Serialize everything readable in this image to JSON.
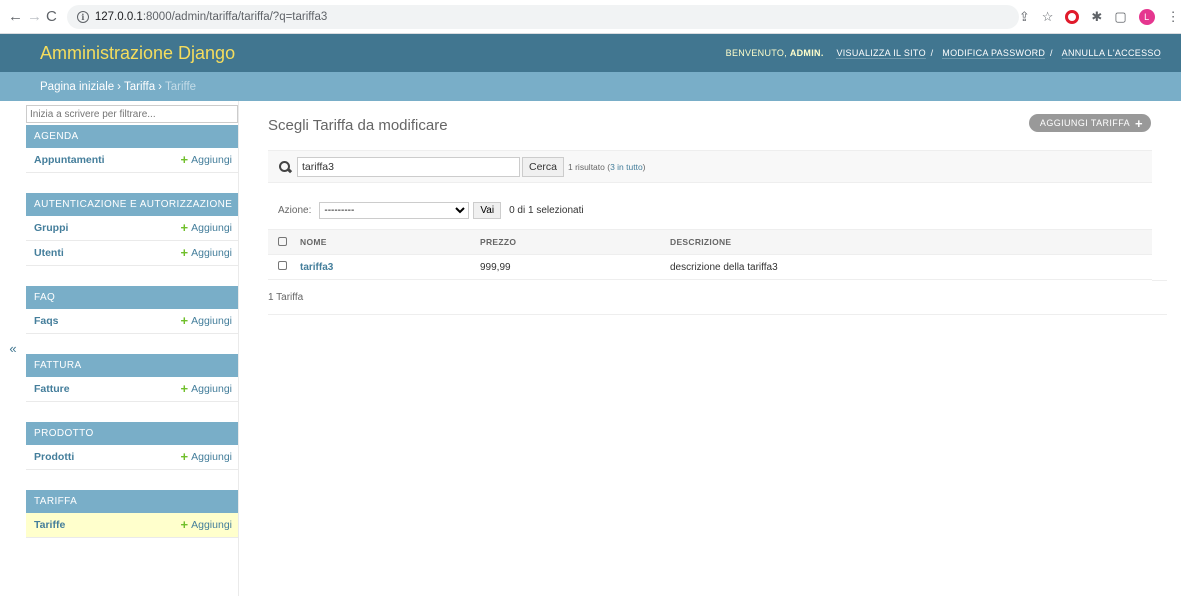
{
  "browser": {
    "url_host": "127.0.0.1",
    "url_path": ":8000/admin/tariffa/tariffa/?q=tariffa3",
    "avatar_letter": "L"
  },
  "header": {
    "branding": "Amministrazione Django",
    "welcome": "Benvenuto,",
    "username": "admin.",
    "view_site": "Visualizza il sito",
    "change_password": "Modifica password",
    "logout": "Annulla l'accesso"
  },
  "breadcrumbs": {
    "home": "Pagina iniziale",
    "app": "Tariffa",
    "current": "Tariffe"
  },
  "sidebar": {
    "toggle": "«",
    "filter_placeholder": "Inizia a scrivere per filtrare...",
    "add_label": "Aggiungi",
    "apps": [
      {
        "caption": "Agenda",
        "models": [
          "Appuntamenti"
        ]
      },
      {
        "caption": "Autenticazione e autorizzazione",
        "models": [
          "Gruppi",
          "Utenti"
        ]
      },
      {
        "caption": "Faq",
        "models": [
          "Faqs"
        ]
      },
      {
        "caption": "Fattura",
        "models": [
          "Fatture"
        ]
      },
      {
        "caption": "Prodotto",
        "models": [
          "Prodotti"
        ]
      },
      {
        "caption": "Tariffa",
        "models": [
          "Tariffe"
        ]
      }
    ]
  },
  "content": {
    "title": "Scegli Tariffa da modificare",
    "add_button": "Aggiungi tariffa",
    "search": {
      "value": "tariffa3",
      "button": "Cerca",
      "result_prefix": "1 risultato (",
      "result_link": "3 in tutto",
      "result_suffix": ")"
    },
    "actions": {
      "label": "Azione:",
      "selected_option": "---------",
      "go_button": "Vai",
      "selection_count": "0 di 1 selezionati"
    },
    "table": {
      "columns": [
        "Nome",
        "Prezzo",
        "Descrizione"
      ],
      "rows": [
        {
          "nome": "tariffa3",
          "prezzo": "999,99",
          "descrizione": "descrizione della tariffa3"
        }
      ]
    },
    "paginator": "1 Tariffa"
  },
  "colors": {
    "header_bg": "#417690",
    "breadcrumbs_bg": "#79aec8",
    "branding": "#f5dd5d",
    "link": "#447e9b",
    "add_green": "#70bf2b",
    "current_row": "#ffffcc"
  }
}
